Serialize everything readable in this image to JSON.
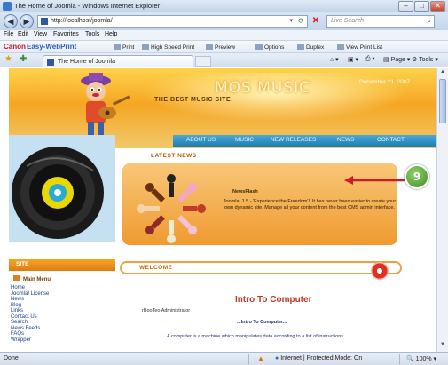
{
  "window": {
    "title": "The Home of Joomla - Windows Internet Explorer"
  },
  "address_bar": {
    "url": "http://localhost/joomla/",
    "search_placeholder": "Live Search"
  },
  "menu": [
    "File",
    "Edit",
    "View",
    "Favorites",
    "Tools",
    "Help"
  ],
  "canon_toolbar": {
    "brand": "Canon",
    "product": "Easy-WebPrint",
    "buttons": [
      "Print",
      "High Speed Print",
      "Preview",
      "Options",
      "Duplex",
      "View Print List"
    ]
  },
  "tab": {
    "label": "The Home of Joomla"
  },
  "tab_tools": [
    "Page",
    "Tools"
  ],
  "page": {
    "site_title": "MOS MUSIC",
    "slogan": "THE BEST MUSIC SITE",
    "date": "December 21, 2007",
    "nav": [
      "ABOUT US",
      "MUSIC",
      "NEW RELEASES",
      "NEWS",
      "CONTACT"
    ],
    "latest_news_heading": "LATEST NEWS",
    "news": {
      "title": "NewsFlash",
      "text": "Joomla! 1.5 - 'Experience the Freedom'!. It has never been easier to create your own dynamic site. Manage all your content from the best CMS admin interface."
    },
    "step_badge": "9",
    "site_panel_heading": "SITE",
    "main_menu_heading": "Main Menu",
    "left_menu": [
      "Home",
      "Joomla! License",
      "News",
      "Blog",
      "Links",
      "Contact Us",
      "Search",
      "News Feeds",
      "FAQs",
      "Wrapper"
    ],
    "welcome_heading": "WELCOME",
    "article": {
      "title": "Intro To Computer",
      "author": "rBooTeo Administrator",
      "subheading": "...Intro To Computer...",
      "body": "A computer is a machine which manipulates data according to a list of instructions."
    }
  },
  "status": {
    "text": "Done",
    "zone": "Internet | Protected Mode: On",
    "zoom": "100%"
  }
}
